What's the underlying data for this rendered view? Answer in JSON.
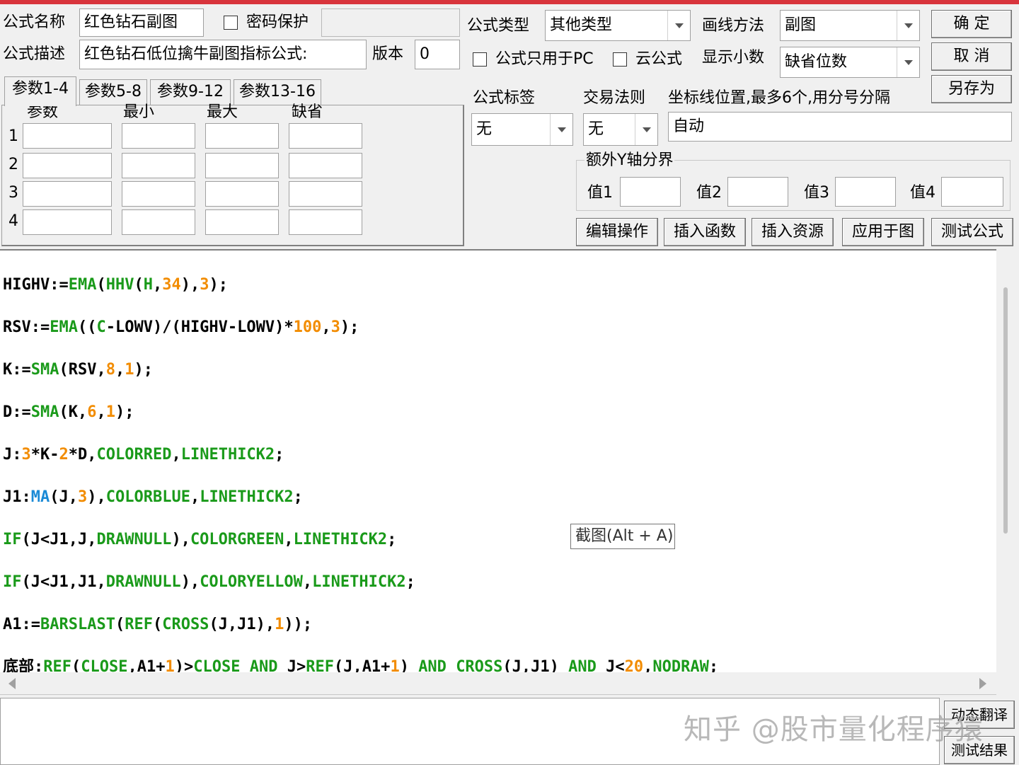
{
  "header": {
    "name_label": "公式名称",
    "name_value": "红色钻石副图",
    "password_label": "密码保护",
    "desc_label": "公式描述",
    "desc_value": "红色钻石低位擒牛副图指标公式:",
    "version_label": "版本",
    "version_value": "0",
    "type_label": "公式类型",
    "type_value": "其他类型",
    "draw_label": "画线方法",
    "draw_value": "副图",
    "pc_only_label": "公式只用于PC",
    "cloud_label": "云公式",
    "decimals_label": "显示小数",
    "decimals_value": "缺省位数"
  },
  "buttons": {
    "ok": "确 定",
    "cancel": "取 消",
    "save_as": "另存为",
    "edit_ops": "编辑操作",
    "insert_func": "插入函数",
    "insert_res": "插入资源",
    "apply_chart": "应用于图",
    "test_formula": "测试公式",
    "dynamic_translate": "动态翻译",
    "test_result": "测试结果"
  },
  "params": {
    "tabs": [
      "参数1-4",
      "参数5-8",
      "参数9-12",
      "参数13-16"
    ],
    "columns": [
      "参数",
      "最小",
      "最大",
      "缺省"
    ],
    "rows": [
      "1",
      "2",
      "3",
      "4"
    ]
  },
  "options": {
    "tag_label": "公式标签",
    "tag_value": "无",
    "trade_label": "交易法则",
    "trade_value": "无",
    "axis_label": "坐标线位置,最多6个,用分号分隔",
    "axis_value": "自动",
    "yaxis_group_label": "额外Y轴分界",
    "yvals": [
      "值1",
      "值2",
      "值3",
      "值4"
    ]
  },
  "tooltip": "截图(Alt + A)",
  "watermark": "知乎 @股市量化程序猿",
  "colors": {
    "function": "#1a9a1a",
    "number": "#f28c00",
    "ma_function": "#1a8ad6",
    "title_bar": "#d8343c"
  }
}
